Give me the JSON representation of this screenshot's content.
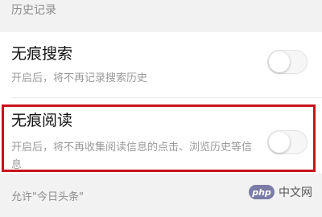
{
  "history_section": {
    "header": "历史记录"
  },
  "incognito_search": {
    "title": "无痕搜索",
    "description": "开启后，将不再记录搜索历史",
    "enabled": false
  },
  "incognito_reading": {
    "title": "无痕阅读",
    "description": "开启后，将不再收集阅读信息的点击、浏览历史等信息",
    "enabled": false
  },
  "permission_section": {
    "header": "允许\"今日头条\""
  },
  "watermark": {
    "badge": "php",
    "text": "中文网"
  },
  "colors": {
    "highlight": "#c8141c",
    "background": "#efefef",
    "row": "#ffffff"
  }
}
